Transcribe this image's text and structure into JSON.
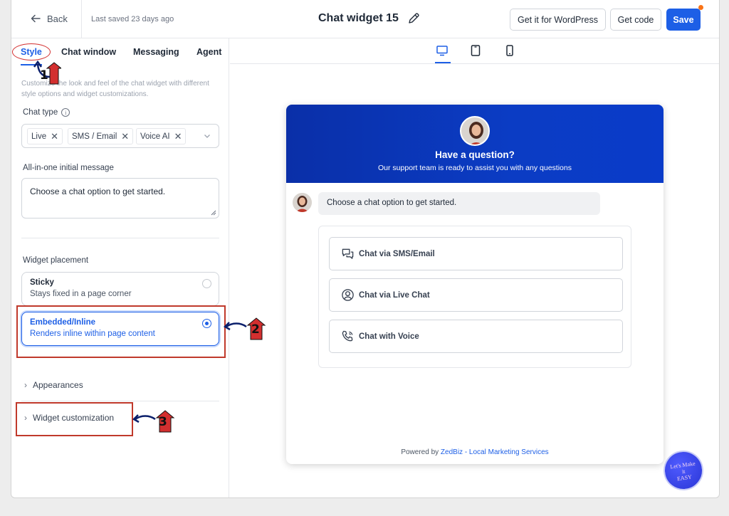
{
  "header": {
    "back_label": "Back",
    "saved_text": "Last saved 23 days ago",
    "title": "Chat widget 15",
    "wordpress_label": "Get it for WordPress",
    "code_label": "Get code",
    "save_label": "Save"
  },
  "tabs": [
    {
      "label": "Style"
    },
    {
      "label": "Chat window"
    },
    {
      "label": "Messaging"
    },
    {
      "label": "Agent"
    }
  ],
  "style_panel": {
    "description": "Customize the look and feel of the chat widget with different style options and widget customizations.",
    "chat_type_label": "Chat type",
    "chat_types": [
      "Live",
      "SMS / Email",
      "Voice AI"
    ],
    "initial_message_label": "All-in-one initial message",
    "initial_message_value": "Choose a chat option to get started.",
    "placement_label": "Widget placement",
    "placement_options": [
      {
        "title": "Sticky",
        "subtitle": "Stays fixed in a page corner",
        "selected": false
      },
      {
        "title": "Embedded/Inline",
        "subtitle": "Renders inline within page content",
        "selected": true
      }
    ],
    "appearances_label": "Appearances",
    "customization_label": "Widget customization"
  },
  "annotations": [
    "1",
    "2",
    "3"
  ],
  "preview": {
    "devices": [
      "desktop",
      "tablet",
      "mobile"
    ],
    "selected_device": "desktop",
    "heading": "Have a question?",
    "subheading": "Our support team is ready to assist you with any questions",
    "bubble_text": "Choose a chat option to get started.",
    "options": [
      {
        "label": "Chat via SMS/Email",
        "icon": "chat-bubbles-icon"
      },
      {
        "label": "Chat via Live Chat",
        "icon": "user-circle-icon"
      },
      {
        "label": "Chat with Voice",
        "icon": "phone-icon"
      }
    ],
    "powered_by": "Powered by",
    "powered_link": "ZedBiz - Local Marketing Services"
  },
  "logo_text": [
    "Let's Make",
    "it",
    "EASY"
  ],
  "colors": {
    "accent": "#1d5fe6",
    "header_gradient_start": "#0a2fa8",
    "annotation_red": "#c0392b",
    "notification_dot": "#f97316"
  }
}
